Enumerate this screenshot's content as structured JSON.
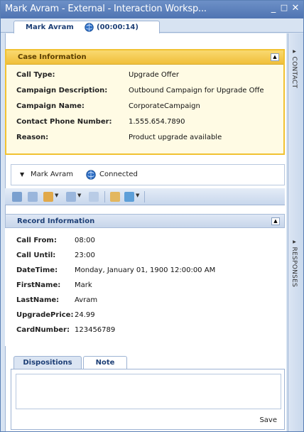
{
  "window": {
    "title": "Mark Avram - External - Interaction Worksp...",
    "controls": {
      "minimize": "_",
      "maximize": "□",
      "close": "✕"
    }
  },
  "call_tab": {
    "name": "Mark Avram",
    "timer": "(00:00:14)",
    "icon": "globe-call-icon"
  },
  "case_information": {
    "title": "Case Information",
    "fields": [
      {
        "label": "Call Type:",
        "value": "Upgrade Offer"
      },
      {
        "label": "Campaign Description:",
        "value": "Outbound Campaign for Upgrade Offe"
      },
      {
        "label": "Campaign Name:",
        "value": "CorporateCampaign"
      },
      {
        "label": "Contact Phone Number:",
        "value": "1.555.654.7890"
      },
      {
        "label": "Reason:",
        "value": "Product upgrade available"
      }
    ]
  },
  "party": {
    "name": "Mark Avram",
    "status": "Connected"
  },
  "record_information": {
    "title": "Record Information",
    "fields": [
      {
        "label": "Call From:",
        "value": "08:00"
      },
      {
        "label": "Call Until:",
        "value": "23:00"
      },
      {
        "label": "DateTime:",
        "value": "Monday, January 01, 1900 12:00:00 AM"
      },
      {
        "label": "FirstName:",
        "value": "Mark"
      },
      {
        "label": "LastName:",
        "value": "Avram"
      },
      {
        "label": "UpgradePrice:",
        "value": "24.99"
      },
      {
        "label": "CardNumber:",
        "value": "123456789"
      }
    ]
  },
  "bottom_tabs": {
    "dispositions": "Dispositions",
    "note": "Note",
    "active": "Note"
  },
  "note": {
    "value": "",
    "save_label": "Save"
  },
  "side_tabs": {
    "contact": "CONTACT",
    "responses": "RESPONSES"
  },
  "colors": {
    "title_bar": "#4f74b2",
    "case_border": "#f1c232",
    "case_header": "#f0bf3a",
    "panel_blue": "#d7e3f2"
  }
}
